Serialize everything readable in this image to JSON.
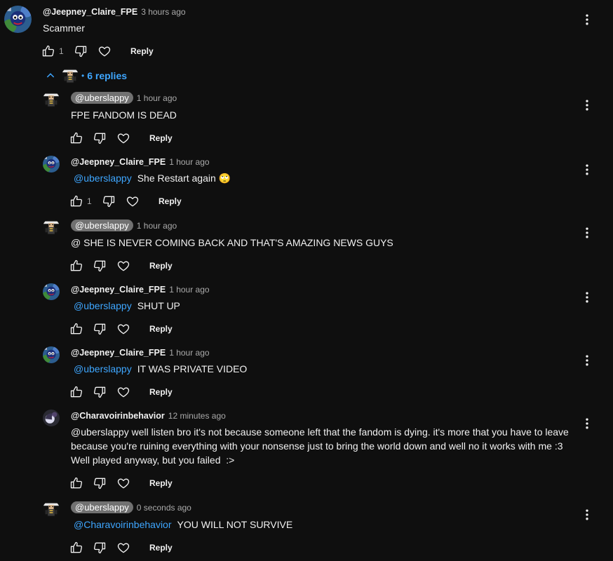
{
  "top_comment": {
    "author": "@Jeepney_Claire_FPE",
    "time": "3 hours ago",
    "text": "Scammer",
    "likes": "1",
    "reply_label": "Reply"
  },
  "replies_toggle": {
    "label": "6 replies"
  },
  "replies": [
    {
      "author": "@uberslappy",
      "time": "1 hour ago",
      "mention": "",
      "text": "FPE FANDOM IS DEAD",
      "likes": "",
      "reply_label": "Reply"
    },
    {
      "author": "@Jeepney_Claire_FPE",
      "time": "1 hour ago",
      "mention": "@uberslappy",
      "text": "She Restart again",
      "emoji": "🙄",
      "likes": "1",
      "reply_label": "Reply"
    },
    {
      "author": "@uberslappy",
      "time": "1 hour ago",
      "mention": "",
      "text": "@ SHE IS NEVER COMING BACK AND THAT'S AMAZING NEWS GUYS",
      "likes": "",
      "reply_label": "Reply"
    },
    {
      "author": "@Jeepney_Claire_FPE",
      "time": "1 hour ago",
      "mention": "@uberslappy",
      "text": "SHUT UP",
      "likes": "",
      "reply_label": "Reply"
    },
    {
      "author": "@Jeepney_Claire_FPE",
      "time": "1 hour ago",
      "mention": "@uberslappy",
      "text": "IT WAS PRIVATE VIDEO",
      "likes": "",
      "reply_label": "Reply"
    },
    {
      "author": "@Charavoirinbehavior",
      "time": "12 minutes ago",
      "mention": "",
      "lines": [
        "@uberslappy well listen bro it's not because someone left that the fandom is dying. it's more that you have to leave",
        "because you're ruining everything with your nonsense just to bring the world down and well no it works with me :3",
        "Well played anyway, but you failed  :>"
      ],
      "likes": "",
      "reply_label": "Reply"
    },
    {
      "author": "@uberslappy",
      "time": "0 seconds ago",
      "mention": "@Charavoirinbehavior",
      "text": "YOU WILL NOT SURVIVE",
      "likes": "",
      "reply_label": "Reply"
    }
  ],
  "icons": {
    "like": "thumbs-up-icon",
    "dislike": "thumbs-down-icon",
    "heart": "heart-icon",
    "menu": "more-vert-icon",
    "toggle": "chevron-up-icon"
  },
  "colors": {
    "background": "#0f0f0f",
    "link": "#3ea6ff",
    "chip": "#717171",
    "secondary": "#aaaaaa"
  }
}
